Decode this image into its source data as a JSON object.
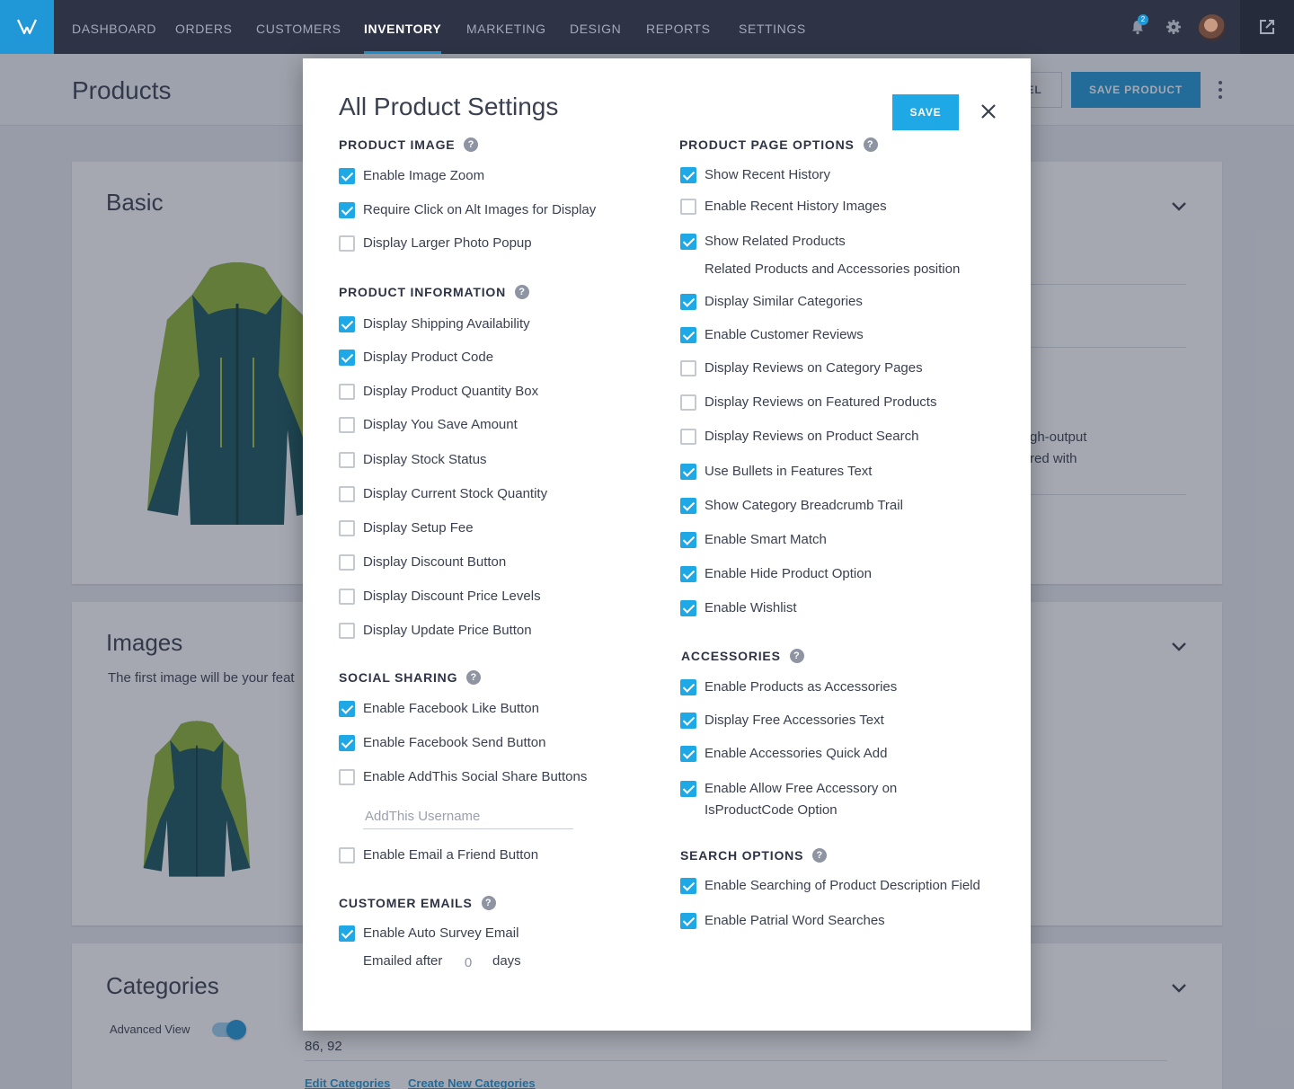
{
  "nav": {
    "items": [
      {
        "label": "DASHBOARD",
        "active": false
      },
      {
        "label": "ORDERS",
        "active": false
      },
      {
        "label": "CUSTOMERS",
        "active": false
      },
      {
        "label": "INVENTORY",
        "active": true
      },
      {
        "label": "MARKETING",
        "active": false
      },
      {
        "label": "DESIGN",
        "active": false
      },
      {
        "label": "REPORTS",
        "active": false
      },
      {
        "label": "SETTINGS",
        "active": false
      }
    ],
    "notification_count": "2",
    "icons": [
      "logo-icon",
      "bell-icon",
      "gear-icon",
      "external-link-icon"
    ],
    "accent_color": "#2097d6"
  },
  "header": {
    "title": "Products",
    "cancel_label": "EL",
    "save_product_label": "SAVE PRODUCT"
  },
  "cards": {
    "basic": {
      "title": "Basic",
      "desc_fragment_1": "gh-output",
      "desc_fragment_2": "red with"
    },
    "images": {
      "title": "Images",
      "subtitle": "The first image will be your feat"
    },
    "categories": {
      "title": "Categories",
      "advanced_view_label": "Advanced View",
      "advanced_view_on": true,
      "category_ids": "86, 92",
      "edit_link": "Edit Categories",
      "create_link": "Create New Categories"
    }
  },
  "modal": {
    "title": "All Product Settings",
    "save_label": "SAVE",
    "left_sections": [
      {
        "title": "PRODUCT IMAGE",
        "options": [
          {
            "label": "Enable Image Zoom",
            "checked": true
          },
          {
            "label": "Require Click on Alt Images for Display",
            "checked": true
          },
          {
            "label": "Display Larger Photo Popup",
            "checked": false
          }
        ]
      },
      {
        "title": "PRODUCT INFORMATION",
        "options": [
          {
            "label": "Display Shipping Availability",
            "checked": true
          },
          {
            "label": "Display Product Code",
            "checked": true
          },
          {
            "label": "Display Product Quantity Box",
            "checked": false
          },
          {
            "label": "Display You Save Amount",
            "checked": false
          },
          {
            "label": "Display Stock Status",
            "checked": false
          },
          {
            "label": "Display Current Stock Quantity",
            "checked": false
          },
          {
            "label": "Display Setup Fee",
            "checked": false
          },
          {
            "label": "Display Discount Button",
            "checked": false
          },
          {
            "label": "Display Discount Price Levels",
            "checked": false
          },
          {
            "label": "Display Update Price Button",
            "checked": false
          }
        ]
      },
      {
        "title": "SOCIAL SHARING",
        "options": [
          {
            "label": "Enable Facebook Like Button",
            "checked": true
          },
          {
            "label": "Enable Facebook Send Button",
            "checked": true
          },
          {
            "label": "Enable AddThis Social Share Buttons",
            "checked": false
          },
          {
            "label": "Enable Email a Friend Button",
            "checked": false
          }
        ],
        "addthis_placeholder": "AddThis Username",
        "addthis_value": ""
      },
      {
        "title": "CUSTOMER EMAILS",
        "options": [
          {
            "label": "Enable Auto Survey Email",
            "checked": true
          }
        ],
        "emailed_after_label": "Emailed after",
        "days_value": "0",
        "days_label": "days"
      }
    ],
    "right_sections": [
      {
        "title": "PRODUCT PAGE OPTIONS",
        "options": [
          {
            "label": "Show Recent History",
            "checked": true
          },
          {
            "label": "Enable Recent History Images",
            "checked": false
          },
          {
            "label": "Show Related Products",
            "checked": true
          },
          {
            "label": "Display Similar Categories",
            "checked": true
          },
          {
            "label": "Enable Customer Reviews",
            "checked": true
          },
          {
            "label": "Display Reviews on Category Pages",
            "checked": false
          },
          {
            "label": "Display Reviews on Featured Products",
            "checked": false
          },
          {
            "label": "Display Reviews on Product Search",
            "checked": false
          },
          {
            "label": "Use Bullets in Features Text",
            "checked": true
          },
          {
            "label": "Show Category Breadcrumb Trail",
            "checked": true
          },
          {
            "label": "Enable Smart Match",
            "checked": true
          },
          {
            "label": "Enable Hide Product Option",
            "checked": true
          },
          {
            "label": "Enable Wishlist",
            "checked": true
          }
        ],
        "related_position_label": "Related Products and Accessories position"
      },
      {
        "title": "ACCESSORIES",
        "options": [
          {
            "label": "Enable Products as Accessories",
            "checked": true
          },
          {
            "label": "Display Free Accessories Text",
            "checked": true
          },
          {
            "label": "Enable Accessories Quick Add",
            "checked": true
          },
          {
            "label": "Enable Allow Free Accessory on",
            "label_line2": "IsProductCode Option",
            "checked": true
          }
        ]
      },
      {
        "title": "SEARCH OPTIONS",
        "options": [
          {
            "label": "Enable Searching of Product Description Field",
            "checked": true
          },
          {
            "label": "Enable Patrial Word Searches",
            "checked": true
          }
        ]
      }
    ]
  }
}
